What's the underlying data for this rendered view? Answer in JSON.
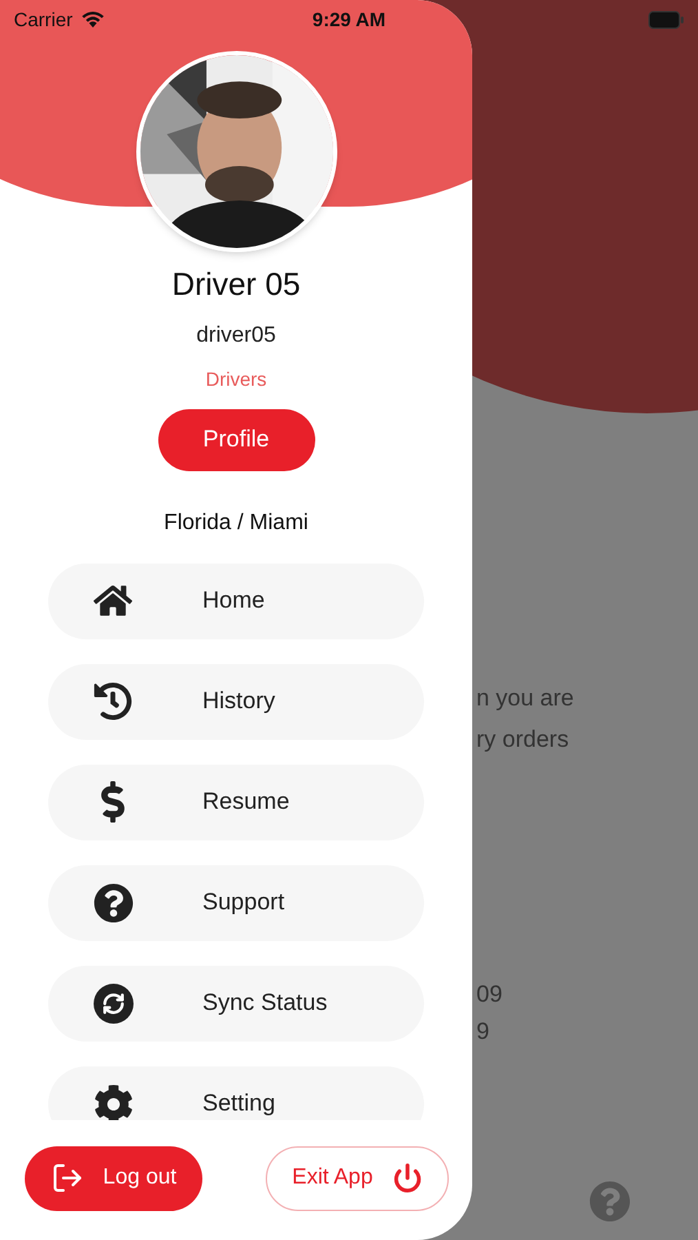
{
  "status_bar": {
    "carrier": "Carrier",
    "time": "9:29 AM"
  },
  "profile": {
    "name": "Driver 05",
    "username": "driver05",
    "role": "Drivers",
    "profile_button": "Profile",
    "location": "Florida / Miami"
  },
  "menu": [
    {
      "label": "Home"
    },
    {
      "label": "History"
    },
    {
      "label": "Resume"
    },
    {
      "label": "Support"
    },
    {
      "label": "Sync Status"
    },
    {
      "label": "Setting"
    }
  ],
  "logout_button": "Log out",
  "exit_button": "Exit App",
  "background_texts": [
    "n you are",
    "ry orders",
    "09",
    "9"
  ]
}
